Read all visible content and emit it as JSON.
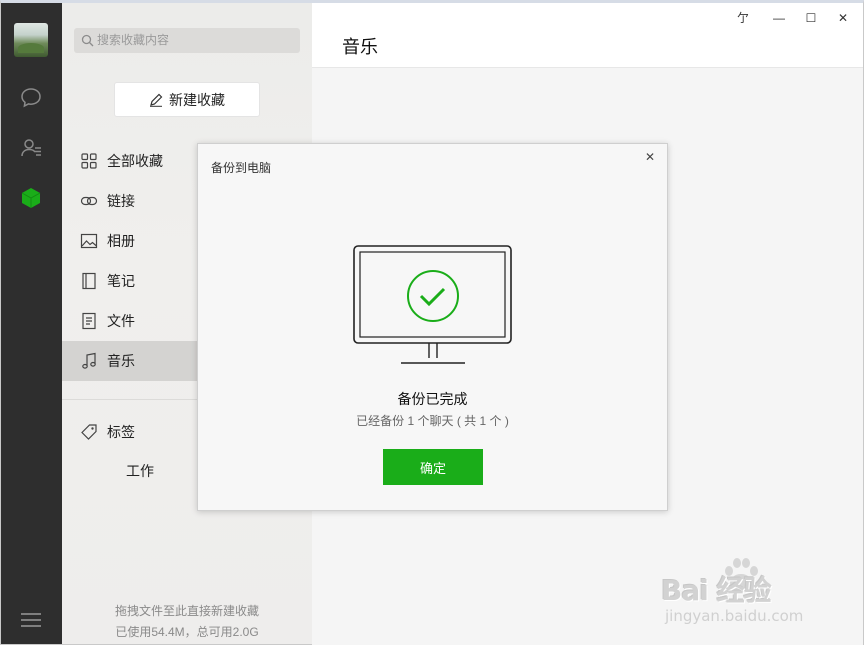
{
  "sidebar": {
    "search_placeholder": "搜索收藏内容",
    "new_button": "新建收藏",
    "items": [
      {
        "label": "全部收藏",
        "icon": "grid-icon"
      },
      {
        "label": "链接",
        "icon": "link-icon"
      },
      {
        "label": "相册",
        "icon": "image-icon"
      },
      {
        "label": "笔记",
        "icon": "notebook-icon"
      },
      {
        "label": "文件",
        "icon": "file-icon"
      },
      {
        "label": "音乐",
        "icon": "music-note-icon",
        "active": true
      }
    ],
    "tags_label": "标签",
    "tag_items": [
      "工作"
    ],
    "footer_hint": "拖拽文件至此直接新建收藏",
    "footer_storage": "已使用54.4M，总可用2.0G"
  },
  "main": {
    "title": "音乐"
  },
  "window_controls": {
    "pin": "亇",
    "minimize": "—",
    "maximize": "☐",
    "close": "✕"
  },
  "dialog": {
    "title": "备份到电脑",
    "close": "✕",
    "status": "备份已完成",
    "detail": "已经备份 1 个聊天 ( 共 1 个 )",
    "ok_button": "确定"
  },
  "watermark": {
    "brand": "Bai  经验",
    "url": "jingyan.baidu.com"
  },
  "colors": {
    "accent_green": "#1aad19",
    "rail_bg": "#2e2e2e",
    "active_item_bg": "#d4d3d1"
  }
}
